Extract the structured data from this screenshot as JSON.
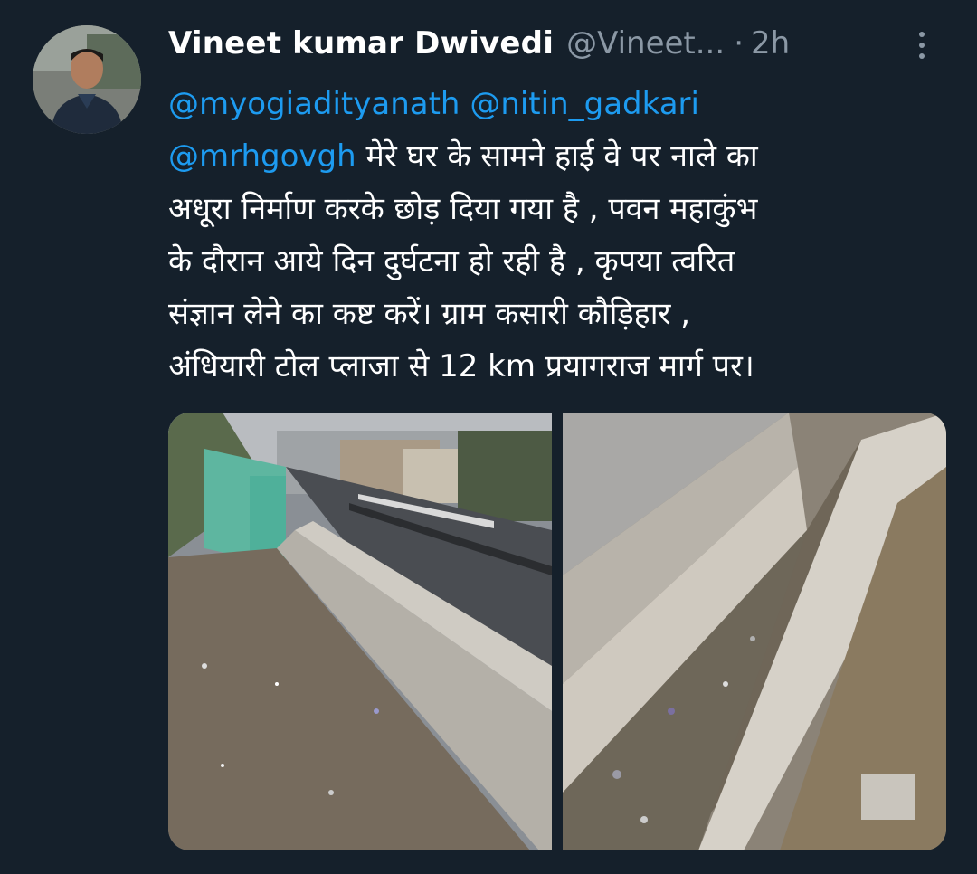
{
  "tweet": {
    "author_name": "Vineet kumar Dwivedi",
    "author_handle": "@Vineet...",
    "separator": "·",
    "timestamp": "2h",
    "more_icon": "more-vertical-icon",
    "mentions": [
      "@myogiadityanath",
      "@nitin_gadkari",
      "@mrhgovgh"
    ],
    "text_lines": [
      "मेरे घर के सामने हाई वे पर नाले का",
      "अधूरा निर्माण करके छोड़ दिया गया है ,  पवन महाकुंभ",
      "के दौरान आये दिन दुर्घटना हो रही है , कृपया त्वरित",
      "संज्ञान लेने का कष्ट करें। ग्राम  कसारी कौड़िहार ,",
      "अंधियारी टोल प्लाजा से 12 km प्रयागराज मार्ग पर।"
    ]
  },
  "colors": {
    "background": "#15202b",
    "text": "#ffffff",
    "secondary": "#8b98a5",
    "link": "#1d9bf0"
  }
}
